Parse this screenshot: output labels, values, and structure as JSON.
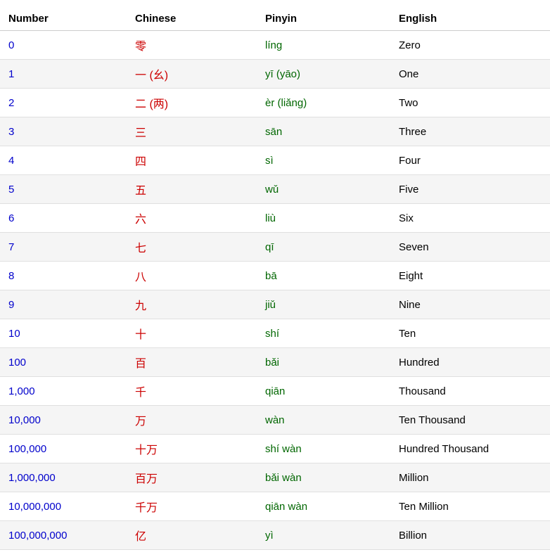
{
  "table": {
    "headers": [
      "Number",
      "Chinese",
      "Pinyin",
      "English"
    ],
    "rows": [
      {
        "number": "0",
        "chinese": "零",
        "pinyin": "líng",
        "english": "Zero"
      },
      {
        "number": "1",
        "chinese": "一 (幺)",
        "pinyin": "yī  (yāo)",
        "english": "One"
      },
      {
        "number": "2",
        "chinese": "二 (两)",
        "pinyin": "èr (liǎng)",
        "english": "Two"
      },
      {
        "number": "3",
        "chinese": "三",
        "pinyin": "sān",
        "english": "Three"
      },
      {
        "number": "4",
        "chinese": "四",
        "pinyin": "sì",
        "english": "Four"
      },
      {
        "number": "5",
        "chinese": "五",
        "pinyin": "wǔ",
        "english": "Five"
      },
      {
        "number": "6",
        "chinese": "六",
        "pinyin": "liù",
        "english": "Six"
      },
      {
        "number": "7",
        "chinese": "七",
        "pinyin": "qī",
        "english": "Seven"
      },
      {
        "number": "8",
        "chinese": "八",
        "pinyin": "bā",
        "english": "Eight"
      },
      {
        "number": "9",
        "chinese": "九",
        "pinyin": "jiǔ",
        "english": "Nine"
      },
      {
        "number": "10",
        "chinese": "十",
        "pinyin": "shí",
        "english": "Ten"
      },
      {
        "number": "100",
        "chinese": "百",
        "pinyin": "bǎi",
        "english": "Hundred"
      },
      {
        "number": "1,000",
        "chinese": "千",
        "pinyin": "qiān",
        "english": "Thousand"
      },
      {
        "number": "10,000",
        "chinese": "万",
        "pinyin": "wàn",
        "english": "Ten Thousand"
      },
      {
        "number": "100,000",
        "chinese": "十万",
        "pinyin": "shí wàn",
        "english": "Hundred Thousand"
      },
      {
        "number": "1,000,000",
        "chinese": "百万",
        "pinyin": "bǎi wàn",
        "english": "Million"
      },
      {
        "number": "10,000,000",
        "chinese": "千万",
        "pinyin": "qiān  wàn",
        "english": "Ten Million"
      },
      {
        "number": "100,000,000",
        "chinese": "亿",
        "pinyin": "yì",
        "english": "Billion"
      }
    ]
  }
}
